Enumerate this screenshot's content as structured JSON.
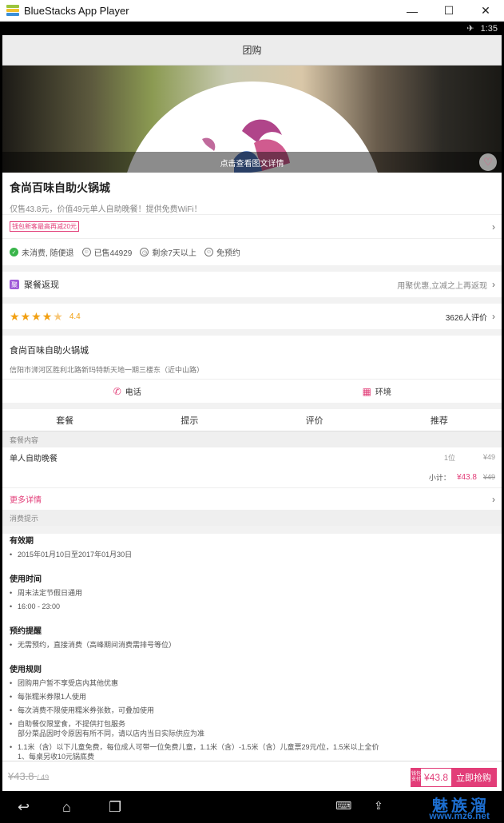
{
  "window": {
    "title": "BlueStacks App Player",
    "minimize": "—",
    "maximize": "☐",
    "close": "✕"
  },
  "statusbar": {
    "time": "1:35"
  },
  "header": {
    "title": "团购"
  },
  "hero": {
    "caption": "点击查看图文详情"
  },
  "deal": {
    "name": "食尚百味自助火锅城",
    "subtitle": "仅售43.8元，价值49元单人自助晚餐！提供免费WiFi！",
    "promo": "钱包新客最高再减20元",
    "features": [
      "未消费, 随便退",
      "已售44929",
      "剩余7天以上",
      "免预约"
    ]
  },
  "juju": {
    "badge": "聚",
    "label": "聚餐返现",
    "right": "用聚优惠,立减之上再返现"
  },
  "rating": {
    "score": "4.4",
    "stars": 4.4,
    "count": "3626人评价"
  },
  "shop": {
    "name": "食尚百味自助火锅城",
    "address": "信阳市浉河区胜利北路新玛特新天地一期三楼东（近中山路）",
    "phone": "电话",
    "env": "环境"
  },
  "tabs": [
    "套餐",
    "提示",
    "评价",
    "推荐"
  ],
  "package": {
    "header": "套餐内容",
    "item": "单人自助晚餐",
    "qty": "1位",
    "price": "¥49",
    "subtotal_label": "小计：",
    "subtotal_now": "¥43.8",
    "subtotal_old": "¥49",
    "more": "更多详情"
  },
  "tips": {
    "header": "消费提示",
    "sections": [
      {
        "title": "有效期",
        "items": [
          "2015年01月10日至2017年01月30日"
        ]
      },
      {
        "title": "使用时间",
        "items": [
          "周末法定节假日通用",
          "16:00 - 23:00"
        ]
      },
      {
        "title": "预约提醒",
        "items": [
          "无需预约，直接消费（高峰期间消费需排号等位）"
        ]
      },
      {
        "title": "使用规则",
        "items": [
          "团购用户暂不享受店内其他优惠",
          "每张糯米券限1人使用",
          "每次消费不限使用糯米券张数，可叠加使用",
          "自助餐仅限堂食，不提供打包服务",
          "1.1米（含）以下儿童免费，每位成人可带一位免费儿童，1.1米（含）-1.5米（含）儿童票29元/位，1.5米以上全价"
        ]
      }
    ],
    "cont_1": "部分菜品因时令原因有所不同，请以店内当日实际供应为准",
    "cont_2": "1、每桌另收10元锅底费"
  },
  "bottom": {
    "old_price": "¥43.8",
    "old_price_sub": "/ 49",
    "tag": "钱包支付",
    "now": "¥43.8",
    "buy": "立即抢购"
  },
  "navbar": {
    "watermark": "魅族溜",
    "url": "www.mz6.net"
  },
  "colors": {
    "accent": "#e23d78",
    "star": "#f2a012",
    "check": "#39b54a"
  }
}
